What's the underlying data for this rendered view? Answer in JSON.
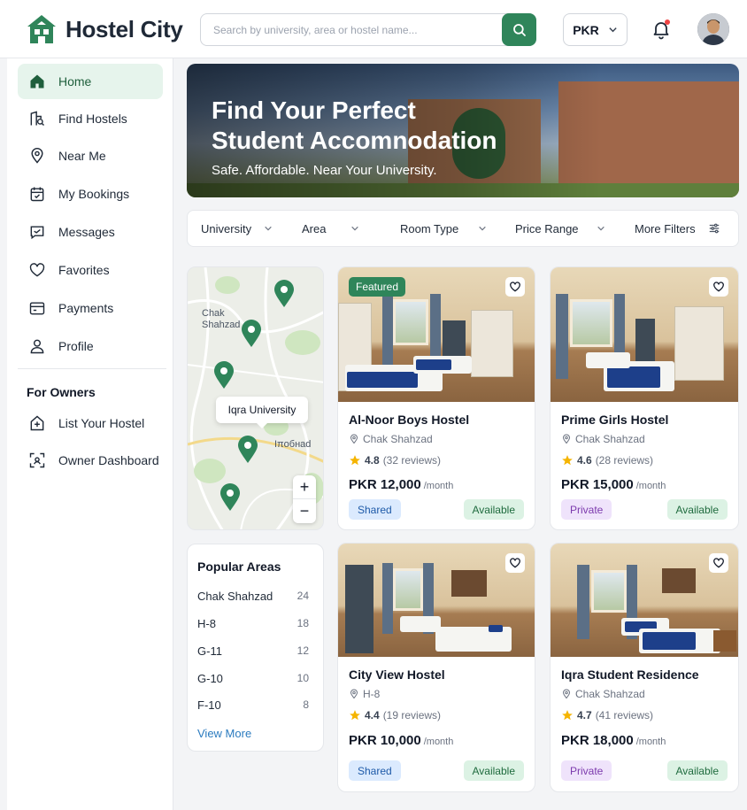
{
  "app": {
    "brand": "Hostel City"
  },
  "search": {
    "placeholder": "Search by university, area or hostel name..."
  },
  "header": {
    "currency": "PKR"
  },
  "sidebar": {
    "items": [
      {
        "label": "Home"
      },
      {
        "label": "Find Hostels"
      },
      {
        "label": "Near Me"
      },
      {
        "label": "My Bookings"
      },
      {
        "label": "Messages"
      },
      {
        "label": "Favorites"
      },
      {
        "label": "Payments"
      },
      {
        "label": "Profile"
      }
    ],
    "owners_title": "For Owners",
    "owner_items": [
      {
        "label": "List Your Hostel"
      },
      {
        "label": "Owner Dashboard"
      }
    ]
  },
  "hero": {
    "title_line1": "Find Your Perfect",
    "title_line2": "Student Accomnodation",
    "subtitle": "Safe. Affordable. Near Your University."
  },
  "filters": [
    {
      "label": "University"
    },
    {
      "label": "Area"
    },
    {
      "label": "Room Type"
    },
    {
      "label": "Price Range"
    },
    {
      "label": "More Filters"
    }
  ],
  "map": {
    "labels": {
      "area1_line1": "Chak",
      "area1_line2": "Shahzad",
      "area2": "Iπoбнad"
    },
    "tooltip": "Iqra University",
    "zoom_in": "+",
    "zoom_out": "−"
  },
  "popular": {
    "title": "Popular Areas",
    "areas": [
      {
        "name": "Chak Shahzad",
        "count": "24"
      },
      {
        "name": "H-8",
        "count": "18"
      },
      {
        "name": "G-11",
        "count": "12"
      },
      {
        "name": "G-10",
        "count": "10"
      },
      {
        "name": "F-10",
        "count": "8"
      }
    ],
    "view_more": "View More"
  },
  "listings": [
    {
      "featured": "Featured",
      "name": "Al-Noor Boys Hostel",
      "location": "Chak Shahzad",
      "rating": "4.8",
      "reviews": "(32 reviews)",
      "price": "PKR 12,000",
      "per": "/month",
      "type": "Shared",
      "status": "Available"
    },
    {
      "name": "Prime Girls Hostel",
      "location": "Chak Shahzad",
      "rating": "4.6",
      "reviews": "(28 reviews)",
      "price": "PKR 15,000",
      "per": "/month",
      "type": "Private",
      "status": "Available"
    },
    {
      "name": "City View Hostel",
      "location": "H-8",
      "rating": "4.4",
      "reviews": "(19 reviews)",
      "price": "PKR 10,000",
      "per": "/month",
      "type": "Shared",
      "status": "Available"
    },
    {
      "name": "Iqra Student Residence",
      "location": "Chak Shahzad",
      "rating": "4.7",
      "reviews": "(41 reviews)",
      "price": "PKR 18,000",
      "per": "/month",
      "type": "Private",
      "status": "Available"
    }
  ],
  "colors": {
    "brand": "#2f855a",
    "active_bg": "#e6f4ec",
    "shared_bg": "#dbeafe",
    "private_bg": "#efe3fb",
    "available_bg": "#dcf2e4"
  },
  "icons": [
    "house-logo-icon",
    "search-icon",
    "chevron-down-icon",
    "bell-icon",
    "home-icon",
    "find-hostels-icon",
    "map-pin-icon",
    "calendar-icon",
    "chat-icon",
    "heart-icon",
    "wallet-icon",
    "user-icon",
    "building-plus-icon",
    "dashboard-icon",
    "filter-sliders-icon",
    "star-icon"
  ]
}
